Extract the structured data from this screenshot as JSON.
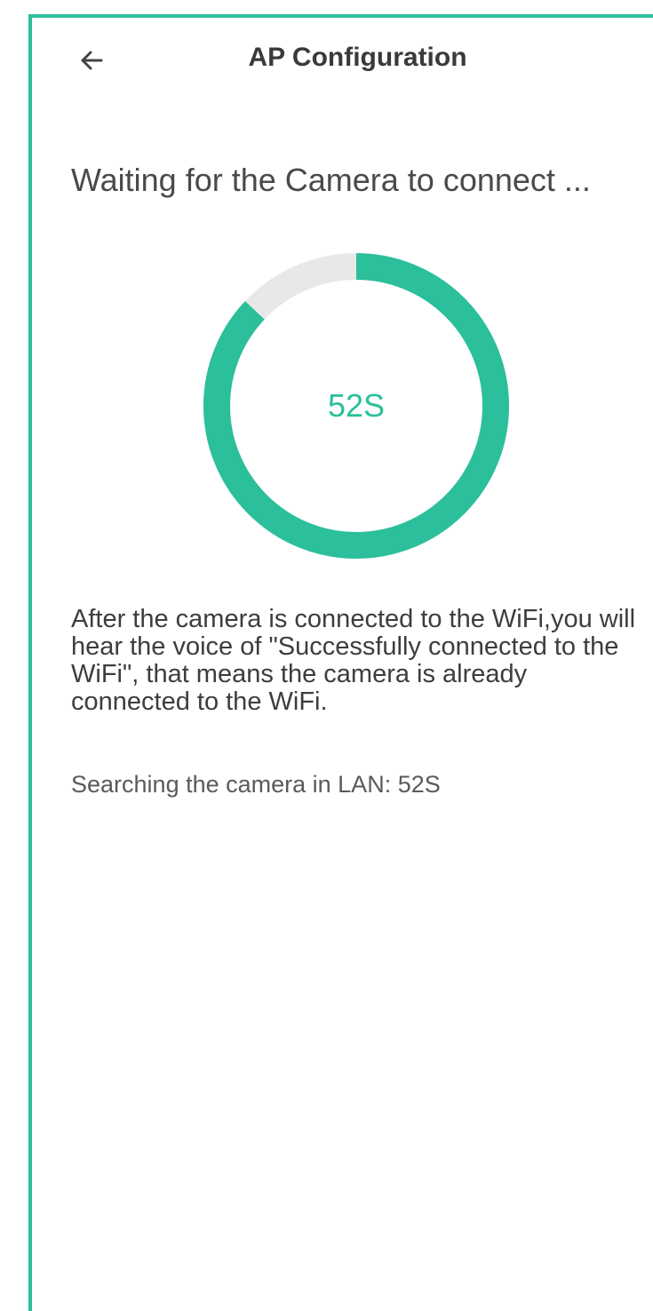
{
  "header": {
    "title": "AP Configuration",
    "back_icon": "arrow-left-icon"
  },
  "main": {
    "waiting_text": "Waiting for the Camera to connect ...",
    "countdown": {
      "label": "52S",
      "remaining_fraction": 0.87,
      "accent_color": "#2bbf9b",
      "track_color": "#e8e8e8"
    },
    "info_text": "After the camera is connected to the WiFi,you will hear the voice of \"Successfully connected to the WiFi\", that means the camera is already connected to the WiFi.",
    "search_status": "Searching the camera in LAN: 52S"
  }
}
